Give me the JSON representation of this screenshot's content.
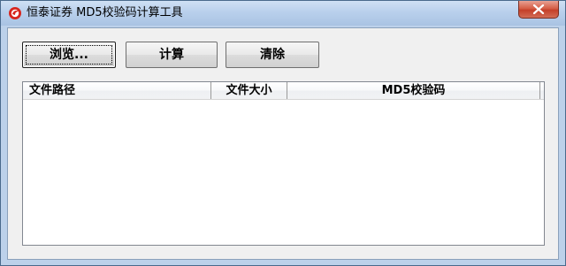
{
  "window": {
    "title": "恒泰证券 MD5校验码计算工具"
  },
  "toolbar": {
    "browse_label": "浏览...",
    "calc_label": "计算",
    "clear_label": "清除"
  },
  "list": {
    "columns": [
      "文件路径",
      "文件大小",
      "MD5校验码"
    ],
    "rows": []
  },
  "icons": {
    "app": "app-logo-icon",
    "close": "close-icon"
  },
  "colors": {
    "close_button": "#c4402a",
    "client_background": "#f0f0f0"
  }
}
